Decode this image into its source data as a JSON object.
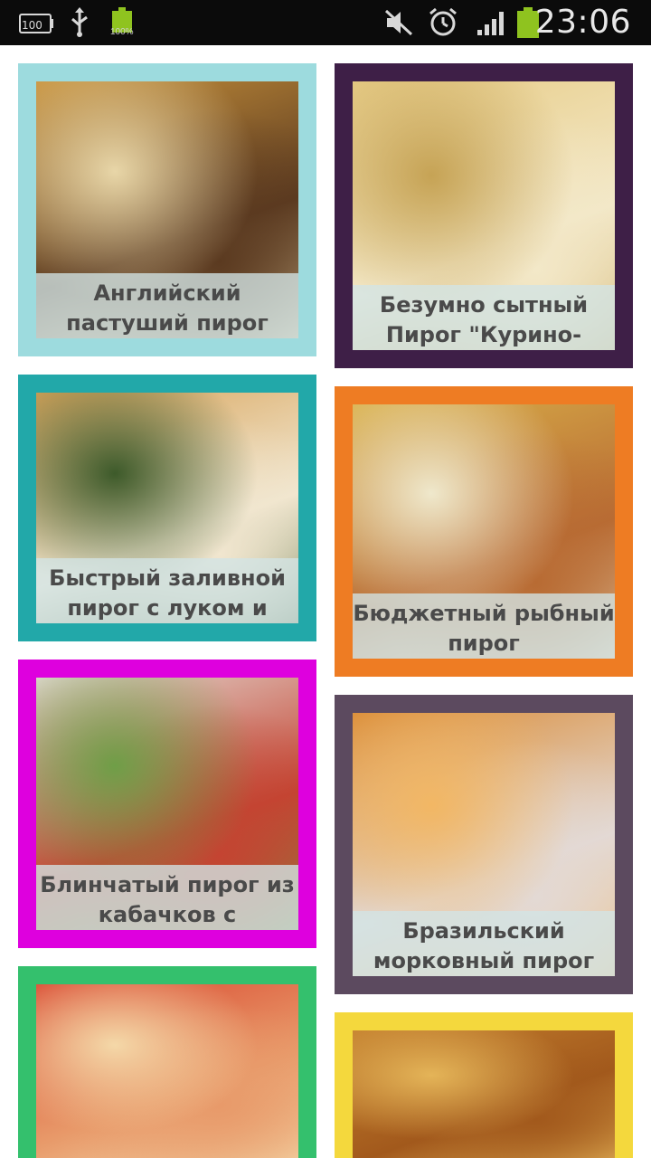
{
  "status_bar": {
    "time": "23:06",
    "battery_small_label": "100%",
    "storage_label": "100",
    "battery_color": "#8fc31f",
    "icons": [
      "storage-icon",
      "usb-icon",
      "battery-charged-icon",
      "mute-icon",
      "alarm-icon",
      "signal-icon",
      "battery-icon"
    ]
  },
  "recipes": [
    {
      "title": "Английский пастуший пирог",
      "frame_color": "#9ddbde",
      "photo_colors": [
        "#c8923b",
        "#5b3a20",
        "#e8d6a8"
      ]
    },
    {
      "title": "Безумно сытный Пирог \"Курино-",
      "frame_color": "#3e1f47",
      "photo_colors": [
        "#e7cc86",
        "#f3e8c8",
        "#c6a355"
      ]
    },
    {
      "title": "Быстрый заливной пирог с луком и",
      "frame_color": "#22a8a9",
      "photo_colors": [
        "#d8a45a",
        "#f1e6cf",
        "#3d5a2a"
      ]
    },
    {
      "title": "Бюджетный рыбный пирог",
      "frame_color": "#ee7c23",
      "photo_colors": [
        "#d9b04a",
        "#b86b33",
        "#efe8cc"
      ]
    },
    {
      "title": "Блинчатый пирог из кабачков с",
      "frame_color": "#de00de",
      "photo_colors": [
        "#e4dcd5",
        "#c44432",
        "#6f9e47"
      ]
    },
    {
      "title": "Бразильский морковный пирог",
      "frame_color": "#5c4a5f",
      "photo_colors": [
        "#d98b36",
        "#e3d9d4",
        "#f2b764"
      ]
    },
    {
      "title": "",
      "frame_color": "#34c06d",
      "photo_colors": [
        "#d9452e",
        "#e89a6a",
        "#f4d8a8"
      ]
    },
    {
      "title": "",
      "frame_color": "#f4d83d",
      "photo_colors": [
        "#c4802e",
        "#a2591c",
        "#e4b458"
      ]
    }
  ]
}
